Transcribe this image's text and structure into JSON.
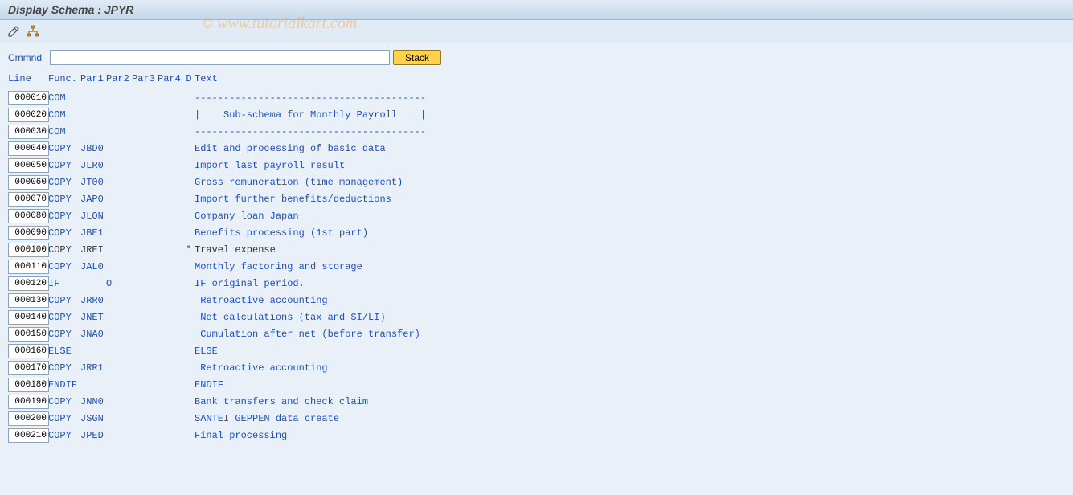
{
  "title": "Display Schema : JPYR",
  "watermark": "© www.tutorialkart.com",
  "toolbar": {
    "edit_icon": "edit-icon",
    "struct_icon": "hierarchy-icon"
  },
  "cmd": {
    "label": "Cmmnd",
    "value": "",
    "stack_label": "Stack"
  },
  "headers": {
    "line": "Line",
    "func": "Func.",
    "par1": "Par1",
    "par2": "Par2",
    "par3": "Par3",
    "par4": "Par4",
    "d": "D",
    "text": "Text"
  },
  "rows": [
    {
      "line": "000010",
      "func": "COM",
      "par1": "",
      "par2": "",
      "par3": "",
      "par4": "",
      "d": "",
      "text": "----------------------------------------",
      "inactive": false
    },
    {
      "line": "000020",
      "func": "COM",
      "par1": "",
      "par2": "",
      "par3": "",
      "par4": "",
      "d": "",
      "text": "|    Sub-schema for Monthly Payroll    |",
      "inactive": false
    },
    {
      "line": "000030",
      "func": "COM",
      "par1": "",
      "par2": "",
      "par3": "",
      "par4": "",
      "d": "",
      "text": "----------------------------------------",
      "inactive": false
    },
    {
      "line": "000040",
      "func": "COPY",
      "par1": "JBD0",
      "par2": "",
      "par3": "",
      "par4": "",
      "d": "",
      "text": "Edit and processing of basic data",
      "inactive": false
    },
    {
      "line": "000050",
      "func": "COPY",
      "par1": "JLR0",
      "par2": "",
      "par3": "",
      "par4": "",
      "d": "",
      "text": "Import last payroll result",
      "inactive": false
    },
    {
      "line": "000060",
      "func": "COPY",
      "par1": "JT00",
      "par2": "",
      "par3": "",
      "par4": "",
      "d": "",
      "text": "Gross remuneration (time management)",
      "inactive": false
    },
    {
      "line": "000070",
      "func": "COPY",
      "par1": "JAP0",
      "par2": "",
      "par3": "",
      "par4": "",
      "d": "",
      "text": "Import further benefits/deductions",
      "inactive": false
    },
    {
      "line": "000080",
      "func": "COPY",
      "par1": "JLON",
      "par2": "",
      "par3": "",
      "par4": "",
      "d": "",
      "text": "Company loan Japan",
      "inactive": false
    },
    {
      "line": "000090",
      "func": "COPY",
      "par1": "JBE1",
      "par2": "",
      "par3": "",
      "par4": "",
      "d": "",
      "text": "Benefits processing (1st part)",
      "inactive": false
    },
    {
      "line": "000100",
      "func": "COPY",
      "par1": "JREI",
      "par2": "",
      "par3": "",
      "par4": "",
      "d": "*",
      "text": "Travel expense",
      "inactive": true
    },
    {
      "line": "000110",
      "func": "COPY",
      "par1": "JAL0",
      "par2": "",
      "par3": "",
      "par4": "",
      "d": "",
      "text": "Monthly factoring and storage",
      "inactive": false
    },
    {
      "line": "000120",
      "func": "IF",
      "par1": "",
      "par2": "O",
      "par3": "",
      "par4": "",
      "d": "",
      "text": "IF original period.",
      "inactive": false
    },
    {
      "line": "000130",
      "func": "COPY",
      "par1": "JRR0",
      "par2": "",
      "par3": "",
      "par4": "",
      "d": "",
      "text": " Retroactive accounting",
      "inactive": false
    },
    {
      "line": "000140",
      "func": "COPY",
      "par1": "JNET",
      "par2": "",
      "par3": "",
      "par4": "",
      "d": "",
      "text": " Net calculations (tax and SI/LI)",
      "inactive": false
    },
    {
      "line": "000150",
      "func": "COPY",
      "par1": "JNA0",
      "par2": "",
      "par3": "",
      "par4": "",
      "d": "",
      "text": " Cumulation after net (before transfer)",
      "inactive": false
    },
    {
      "line": "000160",
      "func": "ELSE",
      "par1": "",
      "par2": "",
      "par3": "",
      "par4": "",
      "d": "",
      "text": "ELSE",
      "inactive": false
    },
    {
      "line": "000170",
      "func": "COPY",
      "par1": "JRR1",
      "par2": "",
      "par3": "",
      "par4": "",
      "d": "",
      "text": " Retroactive accounting",
      "inactive": false
    },
    {
      "line": "000180",
      "func": "ENDIF",
      "par1": "",
      "par2": "",
      "par3": "",
      "par4": "",
      "d": "",
      "text": "ENDIF",
      "inactive": false
    },
    {
      "line": "000190",
      "func": "COPY",
      "par1": "JNN0",
      "par2": "",
      "par3": "",
      "par4": "",
      "d": "",
      "text": "Bank transfers and check claim",
      "inactive": false
    },
    {
      "line": "000200",
      "func": "COPY",
      "par1": "JSGN",
      "par2": "",
      "par3": "",
      "par4": "",
      "d": "",
      "text": "SANTEI GEPPEN data create",
      "inactive": false
    },
    {
      "line": "000210",
      "func": "COPY",
      "par1": "JPED",
      "par2": "",
      "par3": "",
      "par4": "",
      "d": "",
      "text": "Final processing",
      "inactive": false
    }
  ]
}
